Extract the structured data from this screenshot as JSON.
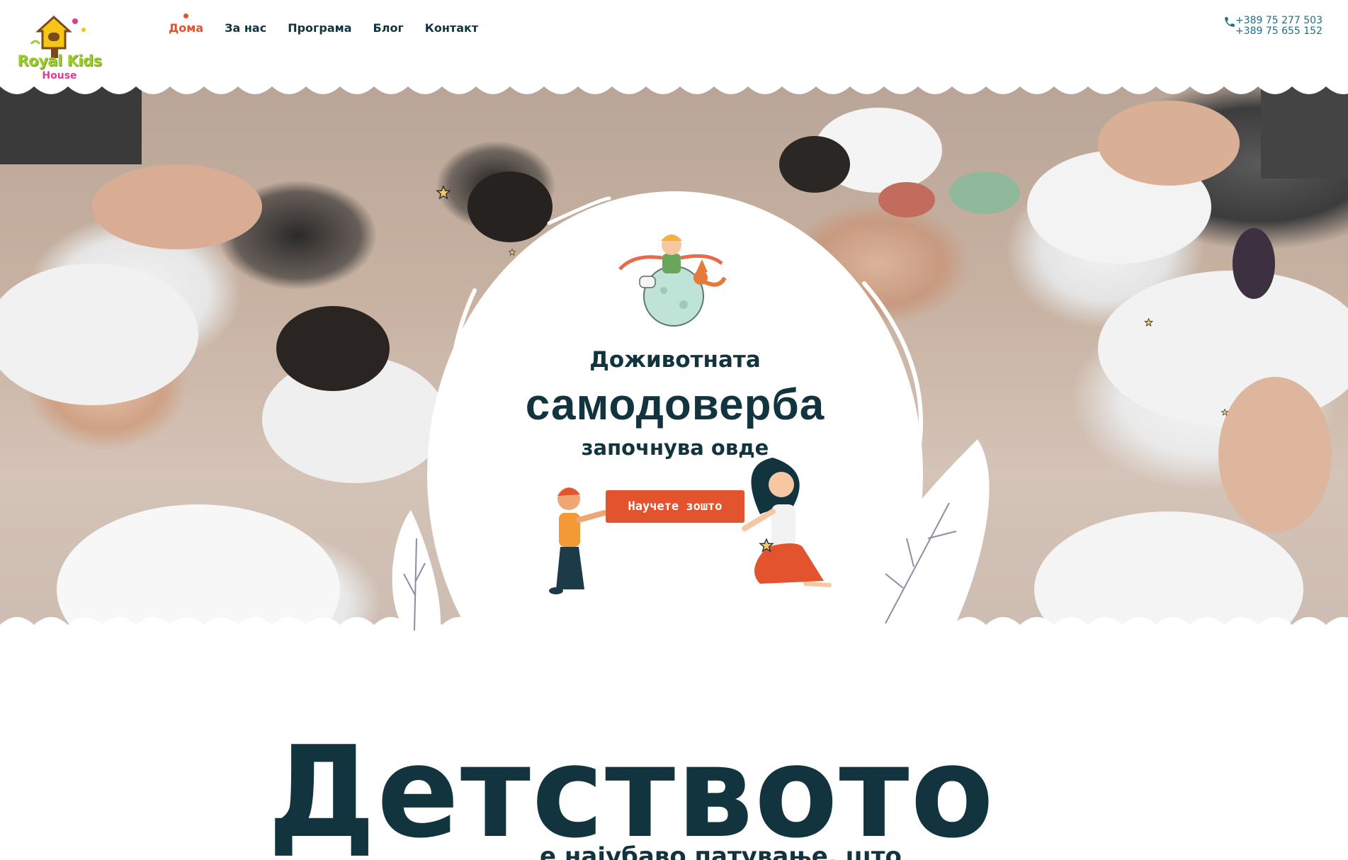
{
  "header": {
    "logo": {
      "name": "Royal Kids",
      "sub": "House"
    },
    "nav": [
      {
        "label": "Дома",
        "active": true
      },
      {
        "label": "За нас",
        "active": false
      },
      {
        "label": "Програма",
        "active": false
      },
      {
        "label": "Блог",
        "active": false
      },
      {
        "label": "Контакт",
        "active": false
      }
    ],
    "phones": [
      "+389 75 277 503",
      "+389 75 655 152"
    ],
    "phone_icon": "phone-icon"
  },
  "hero": {
    "line1": "Доживотната",
    "line2": "самодоверба",
    "line3": "започнува овде",
    "cta_label": "Научете зошто"
  },
  "intro": {
    "title": "Детството",
    "subtitle": "е најубаво патување, што"
  },
  "colors": {
    "accent": "#e2532e",
    "text_dark": "#12343f",
    "phone_blue": "#1c6f86",
    "logo_green": "#9ccc2e",
    "logo_pink": "#e03b8f"
  }
}
